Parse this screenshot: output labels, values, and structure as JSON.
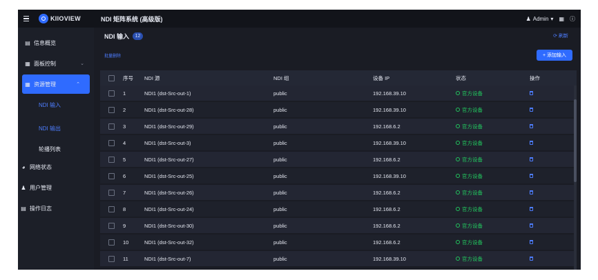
{
  "header": {
    "logo": "KIIOVIEW",
    "title": "NDI 矩阵系统 (高级版)",
    "user": "Admin"
  },
  "sidebar": {
    "items": [
      {
        "label": "信息概览",
        "icon": "monitor-icon"
      },
      {
        "label": "面板控制",
        "icon": "panel-icon"
      },
      {
        "label": "资源管理",
        "icon": "resource-icon"
      },
      {
        "label": "网络状态",
        "icon": "network-icon"
      },
      {
        "label": "用户管理",
        "icon": "user-icon"
      },
      {
        "label": "操作日志",
        "icon": "log-icon"
      }
    ],
    "sub_items": [
      "NDI 输入",
      "NDI 输出",
      "轮播列表"
    ]
  },
  "page": {
    "title": "NDI 输入",
    "count": "12",
    "refresh": "刷新",
    "batch_delete": "批量删除",
    "add_button": "+ 添加输入"
  },
  "table": {
    "columns": [
      "序号",
      "NDI 源",
      "NDI 组",
      "设备 IP",
      "状态",
      "操作"
    ],
    "rows": [
      {
        "idx": "1",
        "src": "NDI1 (dst-Src-out-1)",
        "group": "public",
        "ip": "192.168.39.10",
        "status": "官方设备"
      },
      {
        "idx": "2",
        "src": "NDI1 (dst-Src-out-28)",
        "group": "public",
        "ip": "192.168.39.10",
        "status": "官方设备"
      },
      {
        "idx": "3",
        "src": "NDI1 (dst-Src-out-29)",
        "group": "public",
        "ip": "192.168.6.2",
        "status": "官方设备"
      },
      {
        "idx": "4",
        "src": "NDI1 (dst-Src-out-3)",
        "group": "public",
        "ip": "192.168.39.10",
        "status": "官方设备"
      },
      {
        "idx": "5",
        "src": "NDI1 (dst-Src-out-27)",
        "group": "public",
        "ip": "192.168.6.2",
        "status": "官方设备"
      },
      {
        "idx": "6",
        "src": "NDI1 (dst-Src-out-25)",
        "group": "public",
        "ip": "192.168.39.10",
        "status": "官方设备"
      },
      {
        "idx": "7",
        "src": "NDI1 (dst-Src-out-26)",
        "group": "public",
        "ip": "192.168.6.2",
        "status": "官方设备"
      },
      {
        "idx": "8",
        "src": "NDI1 (dst-Src-out-24)",
        "group": "public",
        "ip": "192.168.6.2",
        "status": "官方设备"
      },
      {
        "idx": "9",
        "src": "NDI1 (dst-Src-out-30)",
        "group": "public",
        "ip": "192.168.6.2",
        "status": "官方设备"
      },
      {
        "idx": "10",
        "src": "NDI1 (dst-Src-out-32)",
        "group": "public",
        "ip": "192.168.6.2",
        "status": "官方设备"
      },
      {
        "idx": "11",
        "src": "NDI1 (dst-Src-out-7)",
        "group": "public",
        "ip": "192.168.39.10",
        "status": "官方设备"
      }
    ]
  },
  "colors": {
    "accent": "#2f6bff",
    "status_ok": "#22c55e",
    "background": "#1a1c24"
  }
}
